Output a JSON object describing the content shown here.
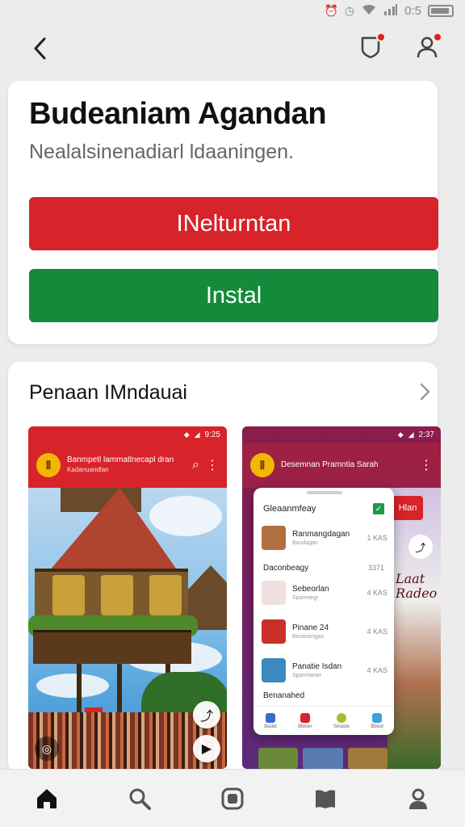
{
  "status_bar": {
    "time": "0:5",
    "icons": [
      "alarm-icon",
      "clock-icon",
      "wifi-icon",
      "signal-icon",
      "battery-icon"
    ]
  },
  "top_bar": {
    "icons": [
      "back-icon",
      "shield-notification-icon",
      "profile-icon"
    ]
  },
  "app": {
    "title": "Budeaniam Agandan",
    "subtitle": "Nealalsinenadiarl ldaaningen.",
    "primary_button": "INelturntan",
    "install_button": "Instal"
  },
  "colors": {
    "red": "#d7232a",
    "green": "#138b3b",
    "background": "#ececec"
  },
  "screenshots_section": {
    "title": "Penaan IMndauai",
    "shot1": {
      "status_time": "9:25",
      "header_title": "Banmpetl lammatlnecapl dran",
      "header_subtitle": "Kadanuandlan"
    },
    "shot2": {
      "status_time": "2:37",
      "header_title": "Desemnan Pramntia Sarah",
      "side_button": "Hlan",
      "overlay_text": "Laat\nRadeo",
      "popup": {
        "title": "Gleaanmfeay",
        "section_label": "Daconbeagy",
        "section_meta": "3371",
        "rows": [
          {
            "label": "Ranmangdagan",
            "sub": "Baudagan",
            "meta": "1 KAS"
          },
          {
            "label": "Sebeorlan",
            "sub": "Spanmegr",
            "meta": "4 KAS"
          },
          {
            "label": "Pinane 24",
            "sub": "Beraniengas",
            "meta": "4 KAS"
          },
          {
            "label": "Panatie Isdan",
            "sub": "Spanmaner",
            "meta": "4 KAS"
          },
          {
            "label": "Benanahed",
            "sub": "",
            "meta": ""
          }
        ],
        "nav": [
          "Baold",
          "Bbiron",
          "Sinaste",
          "Bbiod"
        ]
      }
    }
  },
  "bottom_nav": [
    "home-icon",
    "search-icon",
    "apps-icon",
    "library-icon",
    "profile-icon"
  ]
}
